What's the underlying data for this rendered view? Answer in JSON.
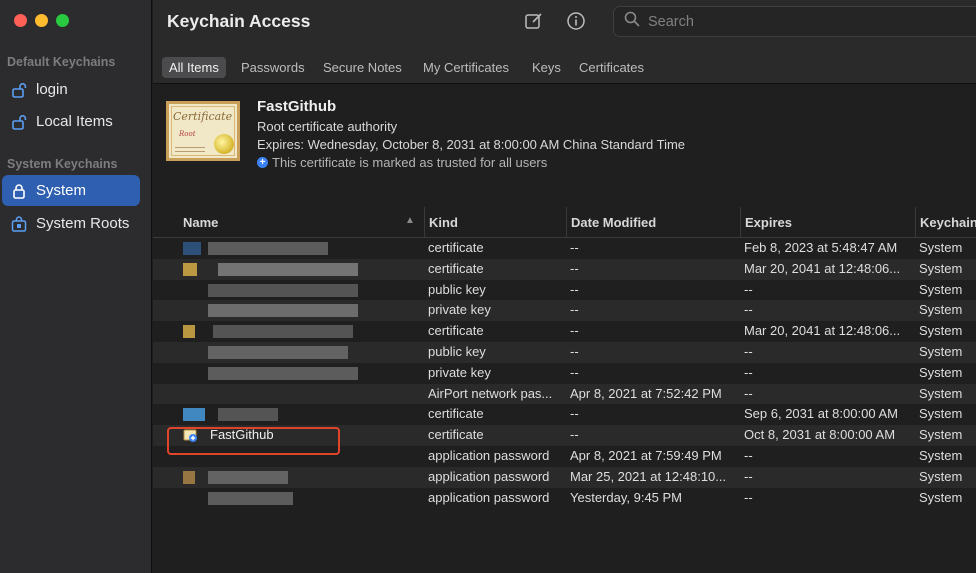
{
  "app": {
    "title": "Keychain Access"
  },
  "sidebar": {
    "sections": [
      {
        "label": "Default Keychains"
      },
      {
        "label": "System Keychains"
      }
    ],
    "items": [
      {
        "label": "login",
        "icon": "lock-open-icon"
      },
      {
        "label": "Local Items",
        "icon": "lock-open-icon"
      },
      {
        "label": "System",
        "icon": "lock-icon"
      },
      {
        "label": "System Roots",
        "icon": "cabinet-lock-icon"
      }
    ],
    "selected": "System"
  },
  "toolbar": {
    "compose_icon": "compose-icon",
    "info_icon": "info-icon",
    "search_placeholder": "Search"
  },
  "tabs": [
    {
      "label": "All Items",
      "active": true
    },
    {
      "label": "Passwords"
    },
    {
      "label": "Secure Notes"
    },
    {
      "label": "My Certificates"
    },
    {
      "label": "Keys"
    },
    {
      "label": "Certificates"
    }
  ],
  "detail": {
    "name": "FastGithub",
    "subtitle": "Root certificate authority",
    "expires": "Expires: Wednesday, October 8, 2031 at 8:00:00 AM China Standard Time",
    "trusted": "This certificate is marked as trusted for all users",
    "image_text": {
      "script": "Certificate",
      "root": "Root"
    }
  },
  "table": {
    "columns": [
      "Name",
      "Kind",
      "Date Modified",
      "Expires",
      "Keychain"
    ],
    "rows": [
      {
        "name": "",
        "kind": "certificate",
        "modified": "--",
        "expires": "Feb 8, 2023 at 5:48:47 AM",
        "keychain": "System"
      },
      {
        "name": "",
        "kind": "certificate",
        "modified": "--",
        "expires": "Mar 20, 2041 at 12:48:06...",
        "keychain": "System"
      },
      {
        "name": "",
        "kind": "public key",
        "modified": "--",
        "expires": "--",
        "keychain": "System"
      },
      {
        "name": "",
        "kind": "private key",
        "modified": "--",
        "expires": "--",
        "keychain": "System"
      },
      {
        "name": "",
        "kind": "certificate",
        "modified": "--",
        "expires": "Mar 20, 2041 at 12:48:06...",
        "keychain": "System"
      },
      {
        "name": "",
        "kind": "public key",
        "modified": "--",
        "expires": "--",
        "keychain": "System"
      },
      {
        "name": "",
        "kind": "private key",
        "modified": "--",
        "expires": "--",
        "keychain": "System"
      },
      {
        "name": "",
        "kind": "AirPort network pas...",
        "modified": "Apr 8, 2021 at 7:52:42 PM",
        "expires": "--",
        "keychain": "System"
      },
      {
        "name": "",
        "kind": "certificate",
        "modified": "--",
        "expires": "Sep 6, 2031 at 8:00:00 AM",
        "keychain": "System"
      },
      {
        "name": "FastGithub",
        "kind": "certificate",
        "modified": "--",
        "expires": "Oct 8, 2031 at 8:00:00 AM",
        "keychain": "System"
      },
      {
        "name": "",
        "kind": "application password",
        "modified": "Apr 8, 2021 at 7:59:49 PM",
        "expires": "--",
        "keychain": "System"
      },
      {
        "name": "",
        "kind": "application password",
        "modified": "Mar 25, 2021 at 12:48:10...",
        "expires": "--",
        "keychain": "System"
      },
      {
        "name": "",
        "kind": "application password",
        "modified": "Yesterday, 9:45 PM",
        "expires": "--",
        "keychain": "System"
      }
    ]
  },
  "colors": {
    "selection": "#2e5fb0",
    "highlight_annotation": "#e0452b"
  }
}
